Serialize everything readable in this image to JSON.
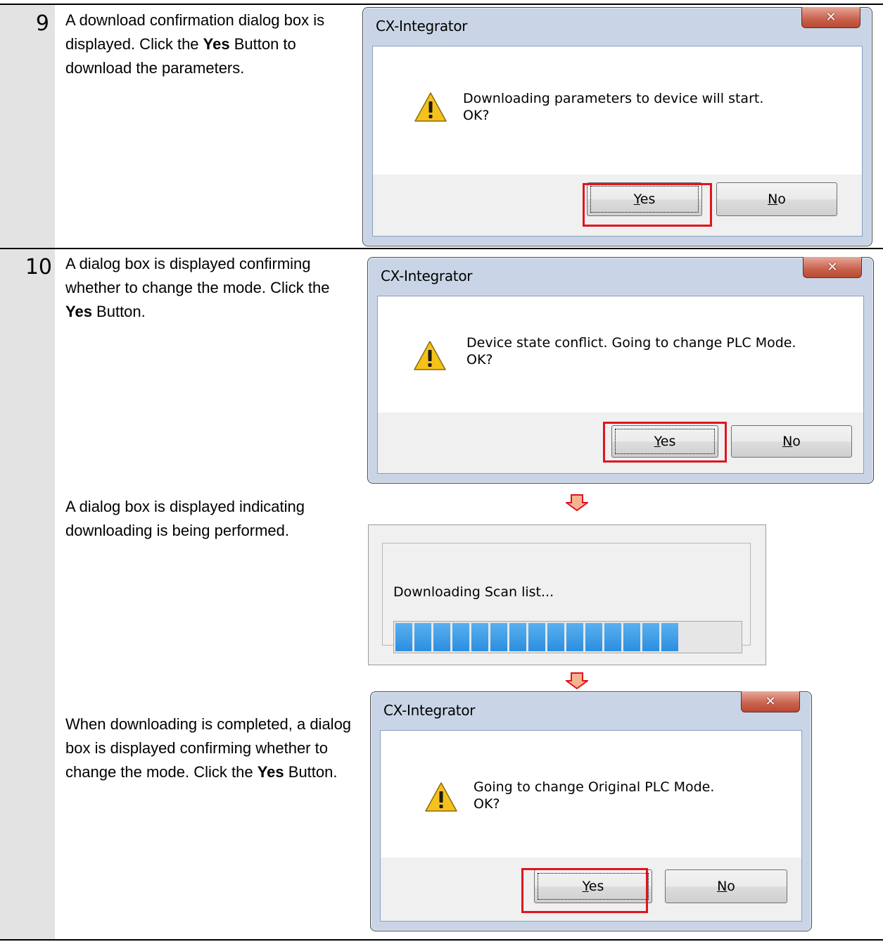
{
  "steps": [
    {
      "number": "9",
      "paragraphs": [
        {
          "text_before": "A download confirmation dialog box is displayed. Click the ",
          "bold": "Yes",
          "text_after": " Button to download the parameters."
        }
      ],
      "dialog": {
        "title": "CX-Integrator",
        "close_icon": "close-icon",
        "message_line1": "Downloading parameters to device will start.",
        "message_line2": "OK?",
        "yes_label": "Yes",
        "no_label": "No"
      }
    },
    {
      "number": "10",
      "paragraphs": [
        {
          "text_before": "A dialog box is displayed confirming whether to change the mode. Click the ",
          "bold": "Yes",
          "text_after": " Button."
        },
        {
          "text_before": "A dialog box is displayed indicating downloading is being performed.",
          "bold": "",
          "text_after": ""
        },
        {
          "text_before": "When downloading is completed, a dialog box is displayed confirming whether to change the mode. Click the ",
          "bold": "Yes",
          "text_after": " Button."
        }
      ],
      "dialog1": {
        "title": "CX-Integrator",
        "message_line1": "Device state conflict. Going to change PLC Mode.",
        "message_line2": "OK?",
        "yes_label": "Yes",
        "no_label": "No"
      },
      "progress": {
        "label": "Downloading Scan list...",
        "progress_fraction": 0.84
      },
      "dialog2": {
        "title": "CX-Integrator",
        "message_line1": "Going to change Original PLC Mode.",
        "message_line2": "OK?",
        "yes_label": "Yes",
        "no_label": "No"
      }
    }
  ],
  "colors": {
    "highlight": "#e0141e",
    "arrow_fill": "#f6b38f",
    "arrow_stroke": "#e0141e",
    "step_column": "#e3e3e3",
    "progress": "#2b8ee0"
  }
}
